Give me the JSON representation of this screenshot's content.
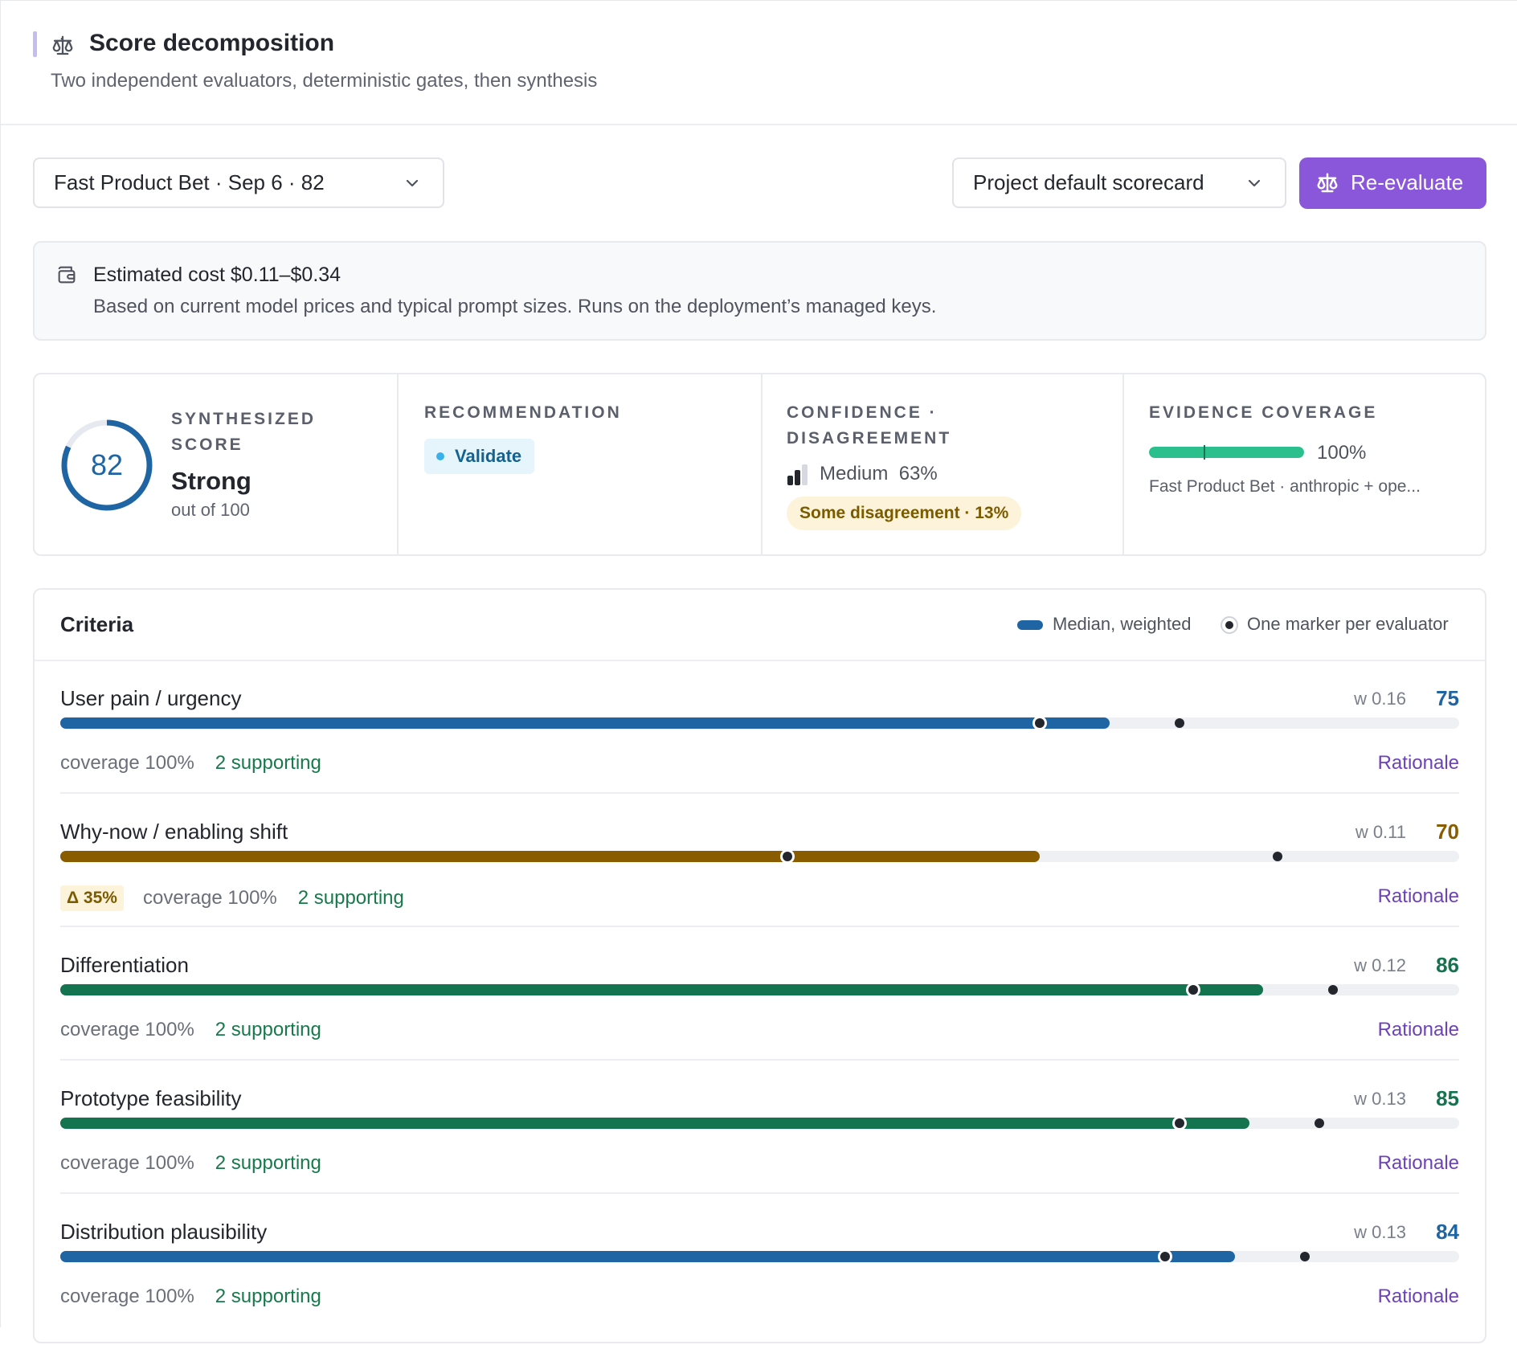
{
  "header": {
    "title": "Score decomposition",
    "subtitle": "Two independent evaluators, deterministic gates, then synthesis",
    "icon": "scale-icon"
  },
  "toolbar": {
    "run_select": "Fast Product Bet · Sep 6 · 82",
    "scorecard_select": "Project default scorecard",
    "reevaluate_label": "Re-evaluate"
  },
  "cost": {
    "title": "Estimated cost $0.11–$0.34",
    "description": "Based on current model prices and typical prompt sizes. Runs on the deployment’s managed keys.",
    "icon": "wallet-icon"
  },
  "stats": {
    "synth_kicker_line1": "SYNTHESIZED",
    "synth_kicker_line2": "SCORE",
    "score": "82",
    "score_value": 82,
    "score_label": "Strong",
    "score_scale": "out of 100",
    "rec_kicker": "RECOMMENDATION",
    "recommendation": "Validate",
    "conf_kicker_line1": "CONFIDENCE ·",
    "conf_kicker_line2": "DISAGREEMENT",
    "confidence": "Medium  63%",
    "disagreement": "Some disagreement · 13%",
    "evidence_kicker": "EVIDENCE COVERAGE",
    "evidence_pct": "100%",
    "evidence_value": 100,
    "evidence_source": "Fast Product Bet · anthropic + ope..."
  },
  "criteria": {
    "title": "Criteria",
    "legend_median": "Median, weighted",
    "legend_marker": "One marker per evaluator",
    "rationale_label": "Rationale",
    "rows": [
      {
        "name": "User pain / urgency",
        "weight": "w 0.16",
        "score": "75",
        "score_value": 75,
        "color": "#1f64a3",
        "evaluators": [
          70,
          80
        ],
        "delta": "",
        "coverage": "coverage 100%",
        "supporting": "2 supporting"
      },
      {
        "name": "Why-now / enabling shift",
        "weight": "w 0.11",
        "score": "70",
        "score_value": 70,
        "color": "#8a5c00",
        "evaluators": [
          52,
          87
        ],
        "delta": "Δ 35%",
        "coverage": "coverage 100%",
        "supporting": "2 supporting"
      },
      {
        "name": "Differentiation",
        "weight": "w 0.12",
        "score": "86",
        "score_value": 86,
        "color": "#13744f",
        "evaluators": [
          81,
          91
        ],
        "delta": "",
        "coverage": "coverage 100%",
        "supporting": "2 supporting"
      },
      {
        "name": "Prototype feasibility",
        "weight": "w 0.13",
        "score": "85",
        "score_value": 85,
        "color": "#13744f",
        "evaluators": [
          80,
          90
        ],
        "delta": "",
        "coverage": "coverage 100%",
        "supporting": "2 supporting"
      },
      {
        "name": "Distribution plausibility",
        "weight": "w 0.13",
        "score": "84",
        "score_value": 84,
        "color": "#1f64a3",
        "evaluators": [
          79,
          89
        ],
        "delta": "",
        "coverage": "coverage 100%",
        "supporting": "2 supporting"
      }
    ]
  }
}
